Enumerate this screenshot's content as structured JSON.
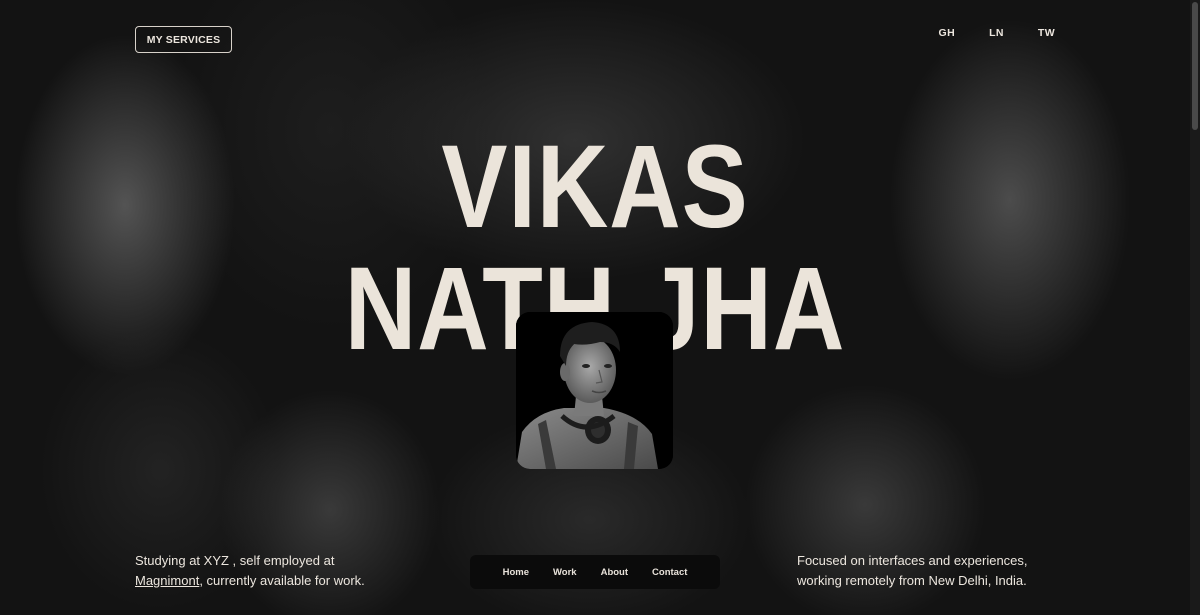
{
  "header": {
    "services_label": "MY SERVICES",
    "social": [
      {
        "label": "GH",
        "icon": "github"
      },
      {
        "label": "LN",
        "icon": "linkedin"
      },
      {
        "label": "TW",
        "icon": "twitter"
      }
    ]
  },
  "hero": {
    "line1": "VIKAS",
    "line2": "NATH JHA"
  },
  "bio_left": {
    "line1": "Studying at XYZ , self employed at",
    "link": "Magnimont",
    "line2_rest": ", currently available for work."
  },
  "bio_right": {
    "line1": "Focused on interfaces and experiences,",
    "line2": "working remotely from New Delhi, India."
  },
  "nav": {
    "items": [
      "Home",
      "Work",
      "About",
      "Contact"
    ]
  },
  "colors": {
    "text": "#ece6de",
    "background": "#131313",
    "nav_bg": "#0b0b0b"
  }
}
